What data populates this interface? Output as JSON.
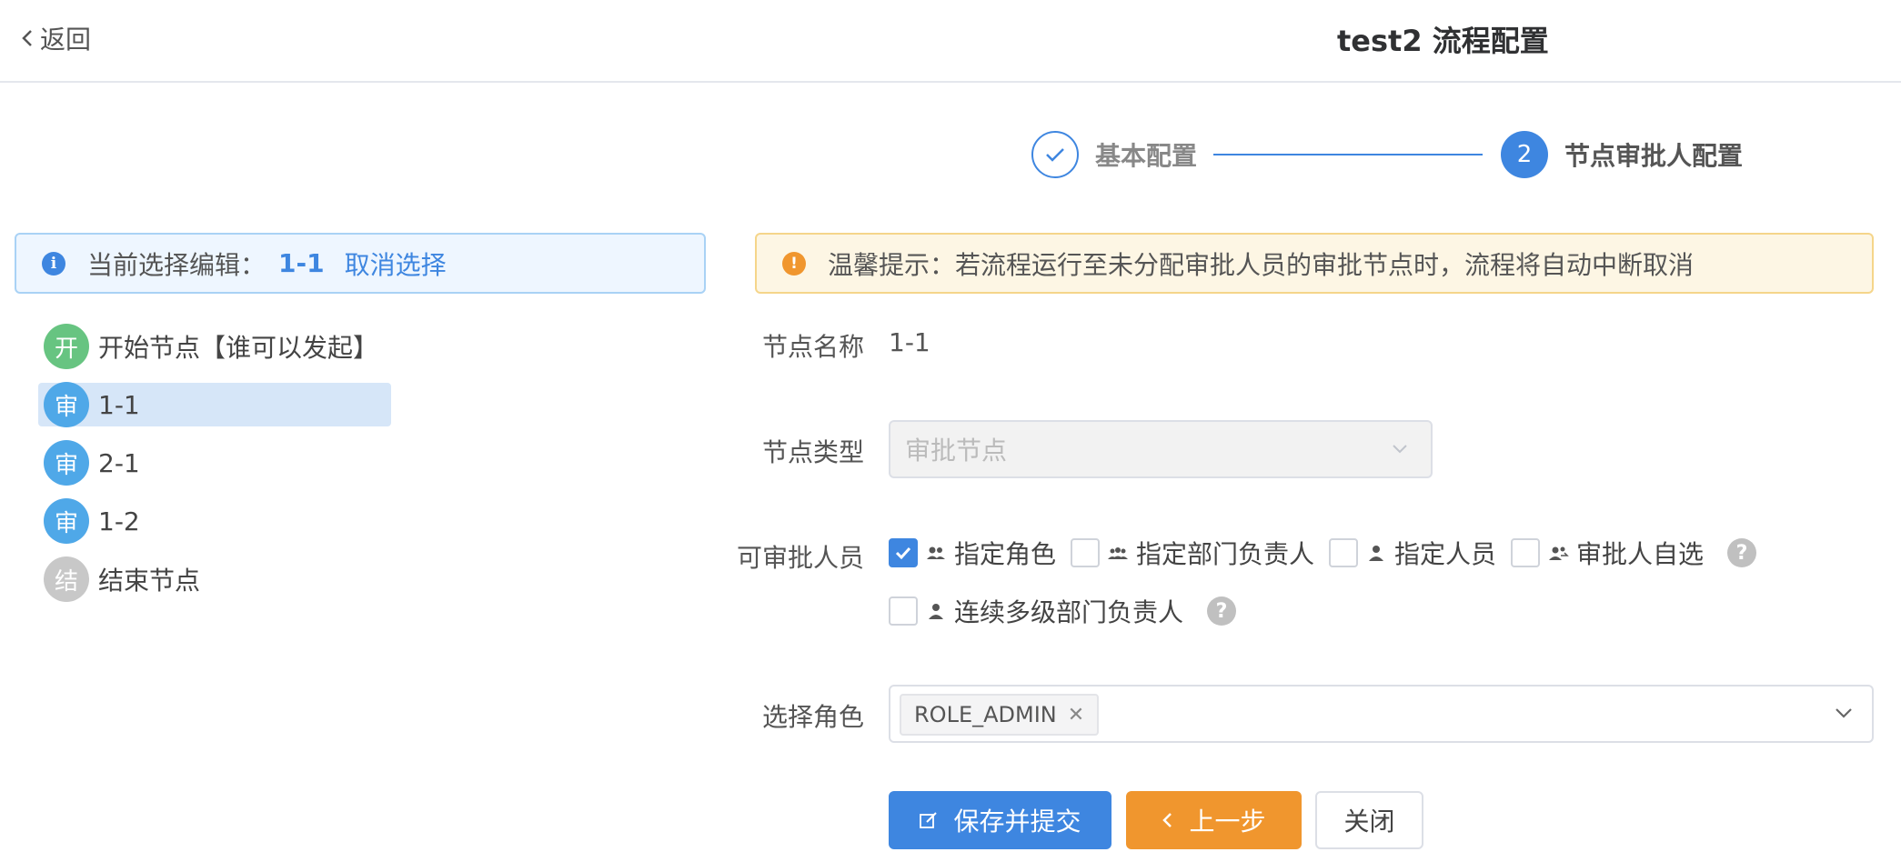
{
  "header": {
    "back_label": "返回",
    "title": "test2 流程配置"
  },
  "steps": [
    {
      "label": "基本配置",
      "status": "done"
    },
    {
      "label": "节点审批人配置",
      "number": "2",
      "status": "active"
    }
  ],
  "info_bar": {
    "icon": "i",
    "text": "当前选择编辑：",
    "selected": "1-1",
    "cancel_label": "取消选择"
  },
  "tree": [
    {
      "badge": "开",
      "label": "开始节点【谁可以发起】",
      "color": "#67c481"
    },
    {
      "badge": "审",
      "label": "1-1",
      "color": "#4fa8e8",
      "selected": true
    },
    {
      "badge": "审",
      "label": "2-1",
      "color": "#4fa8e8"
    },
    {
      "badge": "审",
      "label": "1-2",
      "color": "#4fa8e8"
    },
    {
      "badge": "结",
      "label": "结束节点",
      "color": "#c8c8c8"
    }
  ],
  "warn_bar": {
    "icon": "!",
    "text": "温馨提示：若流程运行至未分配审批人员的审批节点时，流程将自动中断取消"
  },
  "form": {
    "node_name_label": "节点名称",
    "node_name_value": "1-1",
    "node_type_label": "节点类型",
    "node_type_value": "审批节点",
    "approvers_label": "可审批人员",
    "approver_options": [
      {
        "label": "指定角色",
        "checked": true,
        "icon": "users-icon"
      },
      {
        "label": "指定部门负责人",
        "checked": false,
        "icon": "group-icon"
      },
      {
        "label": "指定人员",
        "checked": false,
        "icon": "user-icon"
      },
      {
        "label": "审批人自选",
        "checked": false,
        "icon": "user-switch-icon"
      },
      {
        "label": "连续多级部门负责人",
        "checked": false,
        "icon": "user-icon"
      }
    ],
    "help_glyph": "?",
    "role_label": "选择角色",
    "role_tags": [
      "ROLE_ADMIN"
    ]
  },
  "buttons": {
    "save": "保存并提交",
    "prev": "上一步",
    "close": "关闭"
  },
  "colors": {
    "primary": "#3e86e0",
    "warning": "#f0962e",
    "start_node": "#67c481",
    "approve_node": "#4fa8e8",
    "end_node": "#c8c8c8"
  }
}
